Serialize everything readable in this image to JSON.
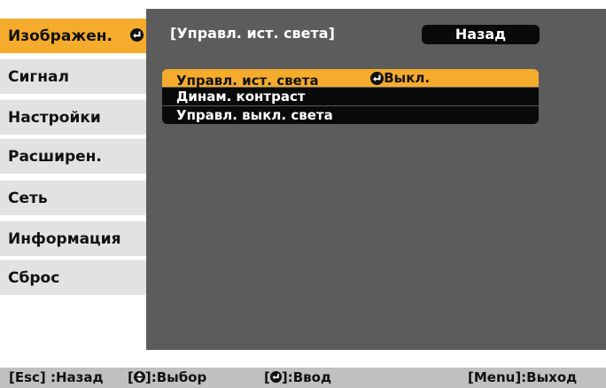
{
  "sidebar": {
    "items": [
      {
        "label": "Изображен.",
        "active": true
      },
      {
        "label": "Сигнал"
      },
      {
        "label": "Настройки"
      },
      {
        "label": "Расширен."
      },
      {
        "label": "Сеть"
      },
      {
        "label": "Информация"
      },
      {
        "label": "Сброс"
      }
    ]
  },
  "panel": {
    "title": "[Управл. ист. света]",
    "back_label": "Назад",
    "rows": [
      {
        "label": "Управл. ист. света",
        "value": "Выкл.",
        "selected": true
      },
      {
        "label": "Динам. контраст",
        "value": ""
      },
      {
        "label": "Управл. выкл. света",
        "value": ""
      }
    ]
  },
  "footer": {
    "esc_hint": "[Esc] :Назад",
    "select_prefix": "[",
    "select_suffix": "]:Выбор",
    "enter_prefix": "[",
    "enter_suffix": "]:Ввод",
    "menu_hint": "[Menu]:Выход"
  },
  "colors": {
    "accent": "#f5ab2c",
    "panel_bg": "#5c5c5c",
    "sidebar_bg": "#e2e2e2",
    "footer_bg": "#c0c0c0"
  },
  "icons": {
    "enter": "enter-icon",
    "updown": "updown-arrows-icon"
  }
}
